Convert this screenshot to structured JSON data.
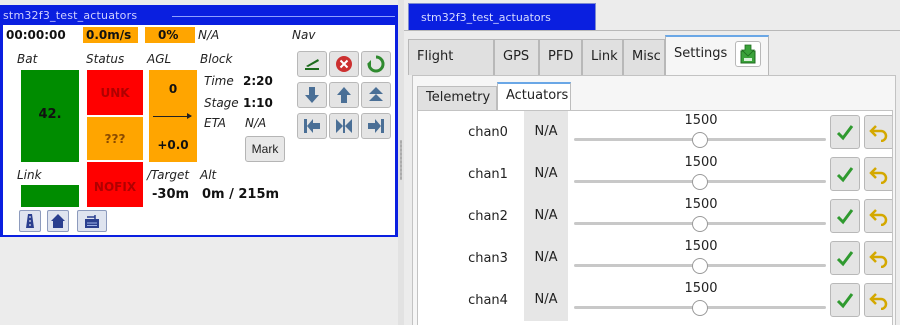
{
  "strip": {
    "title": "stm32f3_test_actuators",
    "time": "00:00:00",
    "speed": "0.0m/s",
    "throttle": "0%",
    "nav_status": "N/A",
    "nav_label": "Nav",
    "bat_label": "Bat",
    "bat_value": "42.",
    "status_label": "Status",
    "status_unk": "UNK",
    "status_qqq": "???",
    "status_nofix": "NOFIX",
    "agl_label": "AGL",
    "agl_value": "0",
    "agl_diff": "+0.0",
    "block_label": "Block",
    "time_label": "Time",
    "time_value": "2:20",
    "stage_label": "Stage",
    "stage_value": "1:10",
    "eta_label": "ETA",
    "eta_value": "N/A",
    "link_label": "Link",
    "target_label": "/Target",
    "alt_label": "Alt",
    "target_value": "-30m",
    "alt_value": "0m / 215m",
    "mark_label": "Mark"
  },
  "settings_panel": {
    "aircraft_tab": "stm32f3_test_actuators",
    "tabs": [
      "Flight Plan",
      "GPS",
      "PFD",
      "Link",
      "Misc",
      "Settings"
    ],
    "active_tab": "Settings",
    "subtabs": [
      "Telemetry",
      "Actuators"
    ],
    "active_subtab": "Actuators",
    "rows": [
      {
        "name": "chan0",
        "current": "N/A",
        "slider": "1500"
      },
      {
        "name": "chan1",
        "current": "N/A",
        "slider": "1500"
      },
      {
        "name": "chan2",
        "current": "N/A",
        "slider": "1500"
      },
      {
        "name": "chan3",
        "current": "N/A",
        "slider": "1500"
      },
      {
        "name": "chan4",
        "current": "N/A",
        "slider": "1500"
      }
    ],
    "slider_fraction": 0.5
  },
  "colors": {
    "strip_blue": "#0a1fe0",
    "warn_orange": "#ffa500",
    "alert_red": "#ff0000",
    "ok_green": "#008c00"
  },
  "icons": {
    "nav": [
      "takeoff-icon",
      "stop-icon",
      "cycle-icon",
      "down-arrow-icon",
      "up-arrow-icon",
      "double-up-arrow-icon",
      "previous-block-icon",
      "center-block-icon",
      "next-block-icon"
    ],
    "bottom": [
      "runway-icon",
      "home-icon",
      "settings-panel-icon"
    ],
    "row_actions": [
      "commit-check-icon",
      "undo-icon"
    ]
  }
}
